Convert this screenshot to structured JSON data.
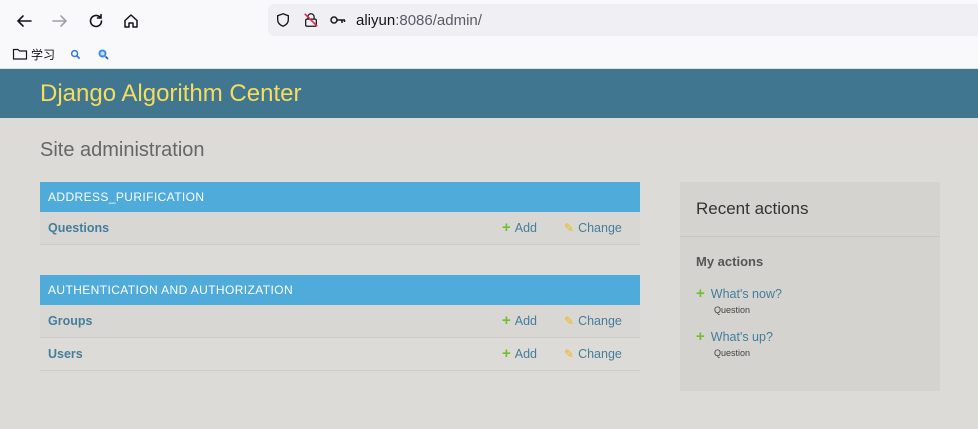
{
  "browser": {
    "url_host": "aliyun",
    "url_rest": ":8086/admin/",
    "bookmarks": [
      {
        "label": "学习",
        "icon": "folder-icon"
      },
      {
        "label": "",
        "icon": "search-icon"
      },
      {
        "label": "",
        "icon": "globe-search-icon"
      }
    ]
  },
  "header": {
    "brand": "Django Algorithm Center",
    "color": "#417690",
    "brand_color": "#f5dd5d"
  },
  "page": {
    "title": "Site administration"
  },
  "modules": [
    {
      "caption": "ADDRESS_PURIFICATION",
      "models": [
        {
          "name": "Questions",
          "add": "Add",
          "change": "Change"
        }
      ]
    },
    {
      "caption": "AUTHENTICATION AND AUTHORIZATION",
      "models": [
        {
          "name": "Groups",
          "add": "Add",
          "change": "Change"
        },
        {
          "name": "Users",
          "add": "Add",
          "change": "Change"
        }
      ]
    }
  ],
  "recent_actions": {
    "title": "Recent actions",
    "subtitle": "My actions",
    "items": [
      {
        "label": "What's now?",
        "type": "Question",
        "icon": "plus-icon"
      },
      {
        "label": "What's up?",
        "type": "Question",
        "icon": "plus-icon"
      }
    ]
  },
  "colors": {
    "caption_bg": "#4fabd9",
    "link": "#447e9b",
    "add_icon": "#70bf2b",
    "change_icon": "#efb80b"
  }
}
